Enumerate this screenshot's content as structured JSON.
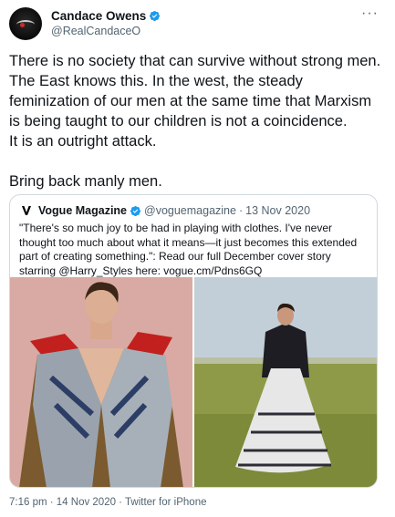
{
  "author": {
    "display_name": "Candace Owens",
    "handle": "@RealCandaceO",
    "verified": true,
    "avatar_icon": "candace-avatar"
  },
  "more_label": "···",
  "tweet": {
    "text": "There is no society that can survive without strong men. The East knows this. In the west, the steady feminization of our men at the same time that Marxism is being taught to our children is not a coincidence.\nIt is an outright attack.\n\nBring back manly men."
  },
  "quoted": {
    "display_name": "Vogue Magazine",
    "handle": "@voguemagazine",
    "separator": "·",
    "date": "13 Nov 2020",
    "verified": true,
    "text": "\"There's so much joy to be had in playing with clothes. I've never thought too much about what it means—it just becomes this extended part of creating something.\": Read our full December cover story starring @Harry_Styles here: vogue.cm/Pdns6GQ",
    "images": [
      "man-in-coat-photo",
      "man-in-dress-field-photo"
    ]
  },
  "footer": {
    "text": "7:16 pm · 14 Nov 2020 · Twitter for iPhone"
  },
  "colors": {
    "accent": "#1d9bf0",
    "text": "#0f1419",
    "muted": "#536471",
    "border": "#cfd9de"
  }
}
